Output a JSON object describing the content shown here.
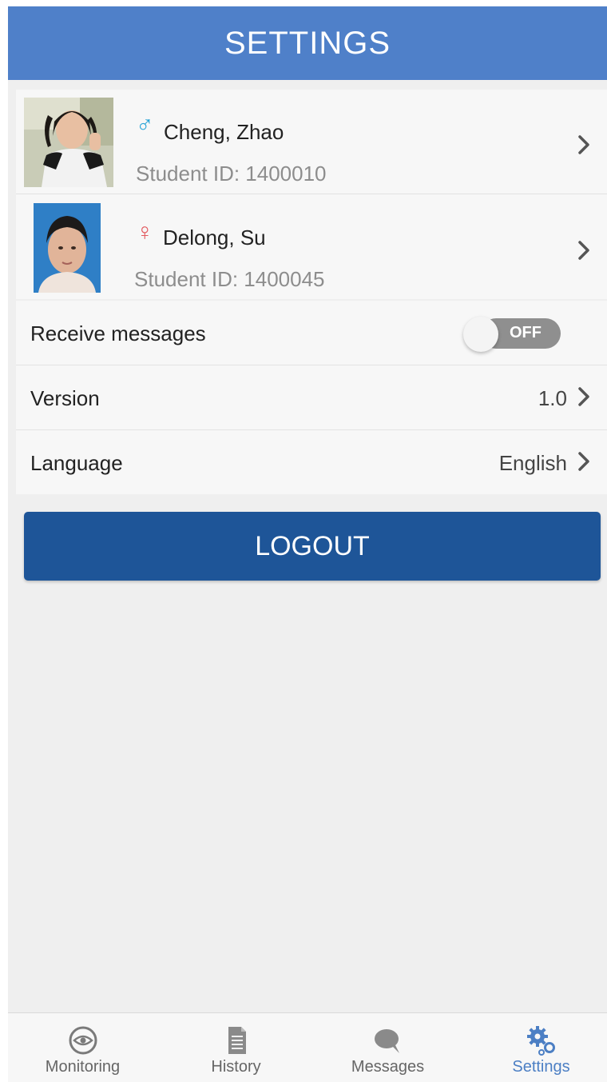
{
  "header": {
    "title": "SETTINGS"
  },
  "students": [
    {
      "gender_symbol": "♂",
      "name": "Cheng, Zhao",
      "student_id": "Student ID:  1400010"
    },
    {
      "gender_symbol": "♀",
      "name": "Delong, Su",
      "student_id": "Student ID:  1400045"
    }
  ],
  "settings": {
    "receive_messages": {
      "label": "Receive messages",
      "toggle_text": "OFF"
    },
    "version": {
      "label": "Version",
      "value": "1.0"
    },
    "language": {
      "label": "Language",
      "value": "English"
    }
  },
  "logout": {
    "label": "LOGOUT"
  },
  "tabs": [
    {
      "label": "Monitoring",
      "icon": "eye-icon"
    },
    {
      "label": "History",
      "icon": "document-icon"
    },
    {
      "label": "Messages",
      "icon": "chat-icon"
    },
    {
      "label": "Settings",
      "icon": "gears-icon"
    }
  ],
  "colors": {
    "header": "#4f80c9",
    "logout": "#1e5598",
    "male": "#27a3d6",
    "female": "#e2585d",
    "active_tab": "#4c7fc4"
  }
}
